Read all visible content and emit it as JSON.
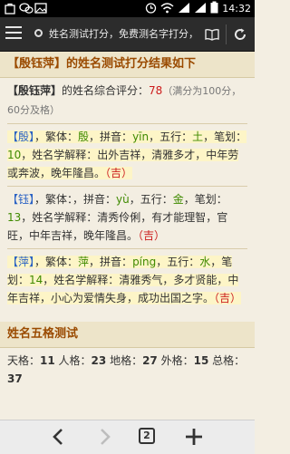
{
  "status_bar": {
    "time": "14:32",
    "icons": [
      "bag-icon",
      "wechat-icon",
      "image-icon",
      "alarm-icon",
      "wifi-icon",
      "signal-icon",
      "signal-icon",
      "battery-icon"
    ]
  },
  "browser": {
    "page_title": "姓名测试打分，免费测名字打分，",
    "tab_count": "2"
  },
  "result": {
    "header": "【殷钰萍】的姓名测试打分结果如下",
    "score_prefix": "【殷钰萍】",
    "score_text": "的姓名综合评分：",
    "score": "78",
    "score_note": "（满分为100分，60分及格）"
  },
  "characters": [
    {
      "char": "【殷】",
      "fanti_label": "，繁体：",
      "fanti": "殷",
      "pinyin_label": "，拼音：",
      "pinyin": "yīn",
      "wuxing_label": "，五行：",
      "wuxing": "土",
      "strokes_label": "，笔划：",
      "strokes": "10",
      "meaning_label": "，姓名学解释：",
      "meaning": "出外吉祥，清雅多才，中年劳或奔波，晚年隆昌。",
      "luck": "（吉）"
    },
    {
      "char": "【钰】",
      "fanti_label": "，繁体：",
      "fanti": "",
      "pinyin_label": "，拼音：",
      "pinyin": "yù",
      "wuxing_label": "，五行：",
      "wuxing": "金",
      "strokes_label": "，笔划：",
      "strokes": "13",
      "meaning_label": "，姓名学解释：",
      "meaning": "清秀伶俐，有才能理智，官旺，中年吉祥，晚年隆昌。",
      "luck": "（吉）"
    },
    {
      "char": "【萍】",
      "fanti_label": "，繁体：",
      "fanti": "萍",
      "pinyin_label": "，拼音：",
      "pinyin": "píng",
      "wuxing_label": "，五行：",
      "wuxing": "水",
      "strokes_label": "，笔划：",
      "strokes": "14",
      "meaning_label": "，姓名学解释：",
      "meaning": "清雅秀气，多才贤能，中年吉祥，小心为爱情失身，成功出国之字。",
      "luck": "（吉）"
    }
  ],
  "wuge": {
    "header": "姓名五格测试",
    "tiange_label": "天格：",
    "tiange": "11",
    "renge_label": " 人格：",
    "renge": "23",
    "dige_label": " 地格：",
    "dige": "27",
    "waige_label": " 外格：",
    "waige": "15",
    "zongge_label": " 总格：",
    "zongge": "37"
  }
}
